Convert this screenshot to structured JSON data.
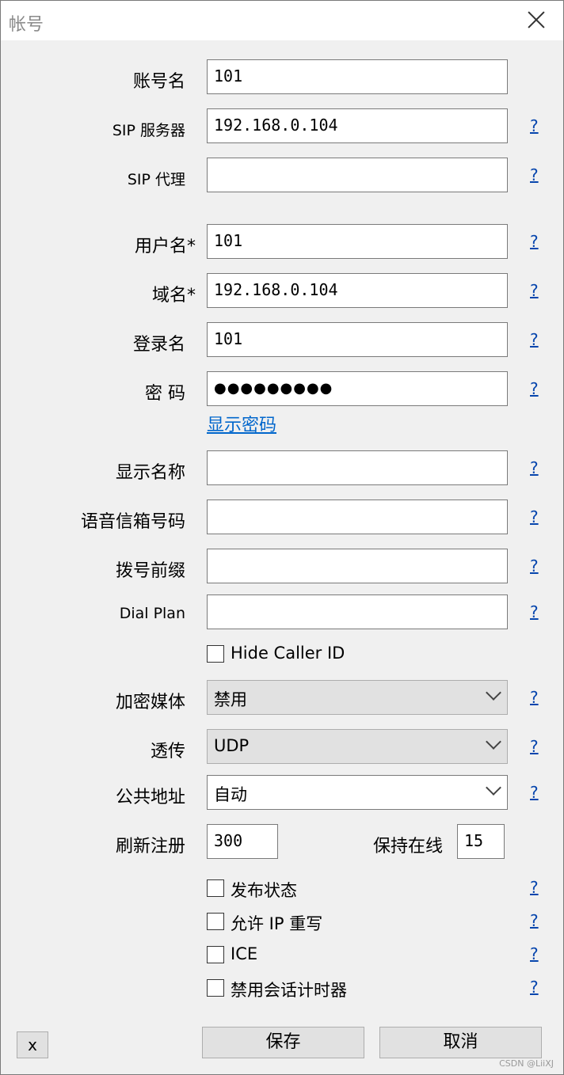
{
  "window": {
    "title": "帐号"
  },
  "fields": {
    "account_name": {
      "label": "账号名",
      "value": "101"
    },
    "sip_server": {
      "label": "SIP 服务器",
      "value": "192.168.0.104",
      "help": "?"
    },
    "sip_proxy": {
      "label": "SIP 代理",
      "value": "",
      "help": "?"
    },
    "username": {
      "label": "用户名*",
      "value": "101",
      "help": "?"
    },
    "domain": {
      "label": "域名*",
      "value": "192.168.0.104",
      "help": "?"
    },
    "login_name": {
      "label": "登录名",
      "value": "101",
      "help": "?"
    },
    "password": {
      "label": "密 码",
      "value": "●●●●●●●●●",
      "help": "?"
    },
    "show_password": "显示密码",
    "display_name": {
      "label": "显示名称",
      "value": "",
      "help": "?"
    },
    "voicemail": {
      "label": "语音信箱号码",
      "value": "",
      "help": "?"
    },
    "dial_prefix": {
      "label": "拨号前缀",
      "value": "",
      "help": "?"
    },
    "dial_plan": {
      "label": "Dial Plan",
      "value": "",
      "help": "?"
    },
    "hide_caller_id": {
      "label": "Hide Caller ID",
      "checked": false
    },
    "encrypt_media": {
      "label": "加密媒体",
      "selected": "禁用",
      "help": "?"
    },
    "transport": {
      "label": "透传",
      "selected": "UDP",
      "help": "?"
    },
    "public_address": {
      "label": "公共地址",
      "selected": "自动",
      "help": "?"
    },
    "refresh_register": {
      "label": "刷新注册",
      "value": "300"
    },
    "keep_alive": {
      "label": "保持在线",
      "value": "15"
    },
    "publish_presence": {
      "label": "发布状态",
      "checked": false,
      "help": "?"
    },
    "allow_ip_rewrite": {
      "label": "允许 IP 重写",
      "checked": false,
      "help": "?"
    },
    "ice": {
      "label": "ICE",
      "checked": false,
      "help": "?"
    },
    "disable_session_timer": {
      "label": "禁用会话计时器",
      "checked": false,
      "help": "?"
    }
  },
  "buttons": {
    "x": "x",
    "save": "保存",
    "cancel": "取消"
  },
  "watermark": "CSDN @LiiXJ"
}
